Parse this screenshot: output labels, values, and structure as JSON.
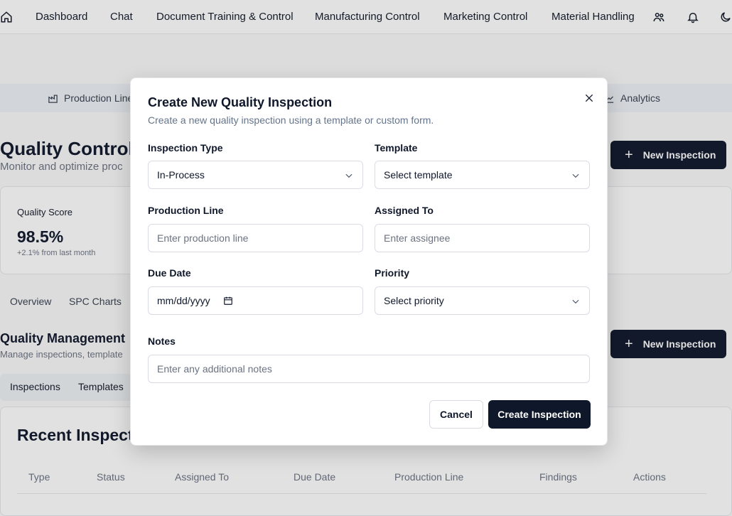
{
  "nav": {
    "items": [
      "Dashboard",
      "Chat",
      "Document Training & Control",
      "Manufacturing Control",
      "Marketing Control",
      "Material Handling"
    ]
  },
  "subtabs": {
    "production": "Production Line",
    "analytics": "Analytics"
  },
  "background": {
    "title": "Quality Control",
    "subtitle": "Monitor and optimize proc",
    "new_inspection": "New Inspection",
    "card": {
      "label": "Quality Score",
      "value": "98.5%",
      "delta": "+2.1% from last month"
    },
    "tabs": [
      "Overview",
      "SPC Charts"
    ],
    "qm_title": "Quality Management",
    "qm_subtitle": "Manage inspections, template",
    "seg": [
      "Inspections",
      "Templates"
    ],
    "recent_title": "Recent Inspectio",
    "table_headers": [
      "Type",
      "Status",
      "Assigned To",
      "Due Date",
      "Production Line",
      "Findings",
      "Actions"
    ]
  },
  "modal": {
    "title": "Create New Quality Inspection",
    "description": "Create a new quality inspection using a template or custom form.",
    "fields": {
      "inspection_type": {
        "label": "Inspection Type",
        "value": "In-Process"
      },
      "template": {
        "label": "Template",
        "placeholder": "Select template"
      },
      "production_line": {
        "label": "Production Line",
        "placeholder": "Enter production line"
      },
      "assigned_to": {
        "label": "Assigned To",
        "placeholder": "Enter assignee"
      },
      "due_date": {
        "label": "Due Date",
        "placeholder": "mm/dd/yyyy"
      },
      "priority": {
        "label": "Priority",
        "placeholder": "Select priority"
      },
      "notes": {
        "label": "Notes",
        "placeholder": "Enter any additional notes"
      }
    },
    "cancel_label": "Cancel",
    "create_label": "Create Inspection"
  },
  "colors": {
    "primary": "#0f172a",
    "muted_text": "#64748b",
    "border": "#d9dde3"
  }
}
